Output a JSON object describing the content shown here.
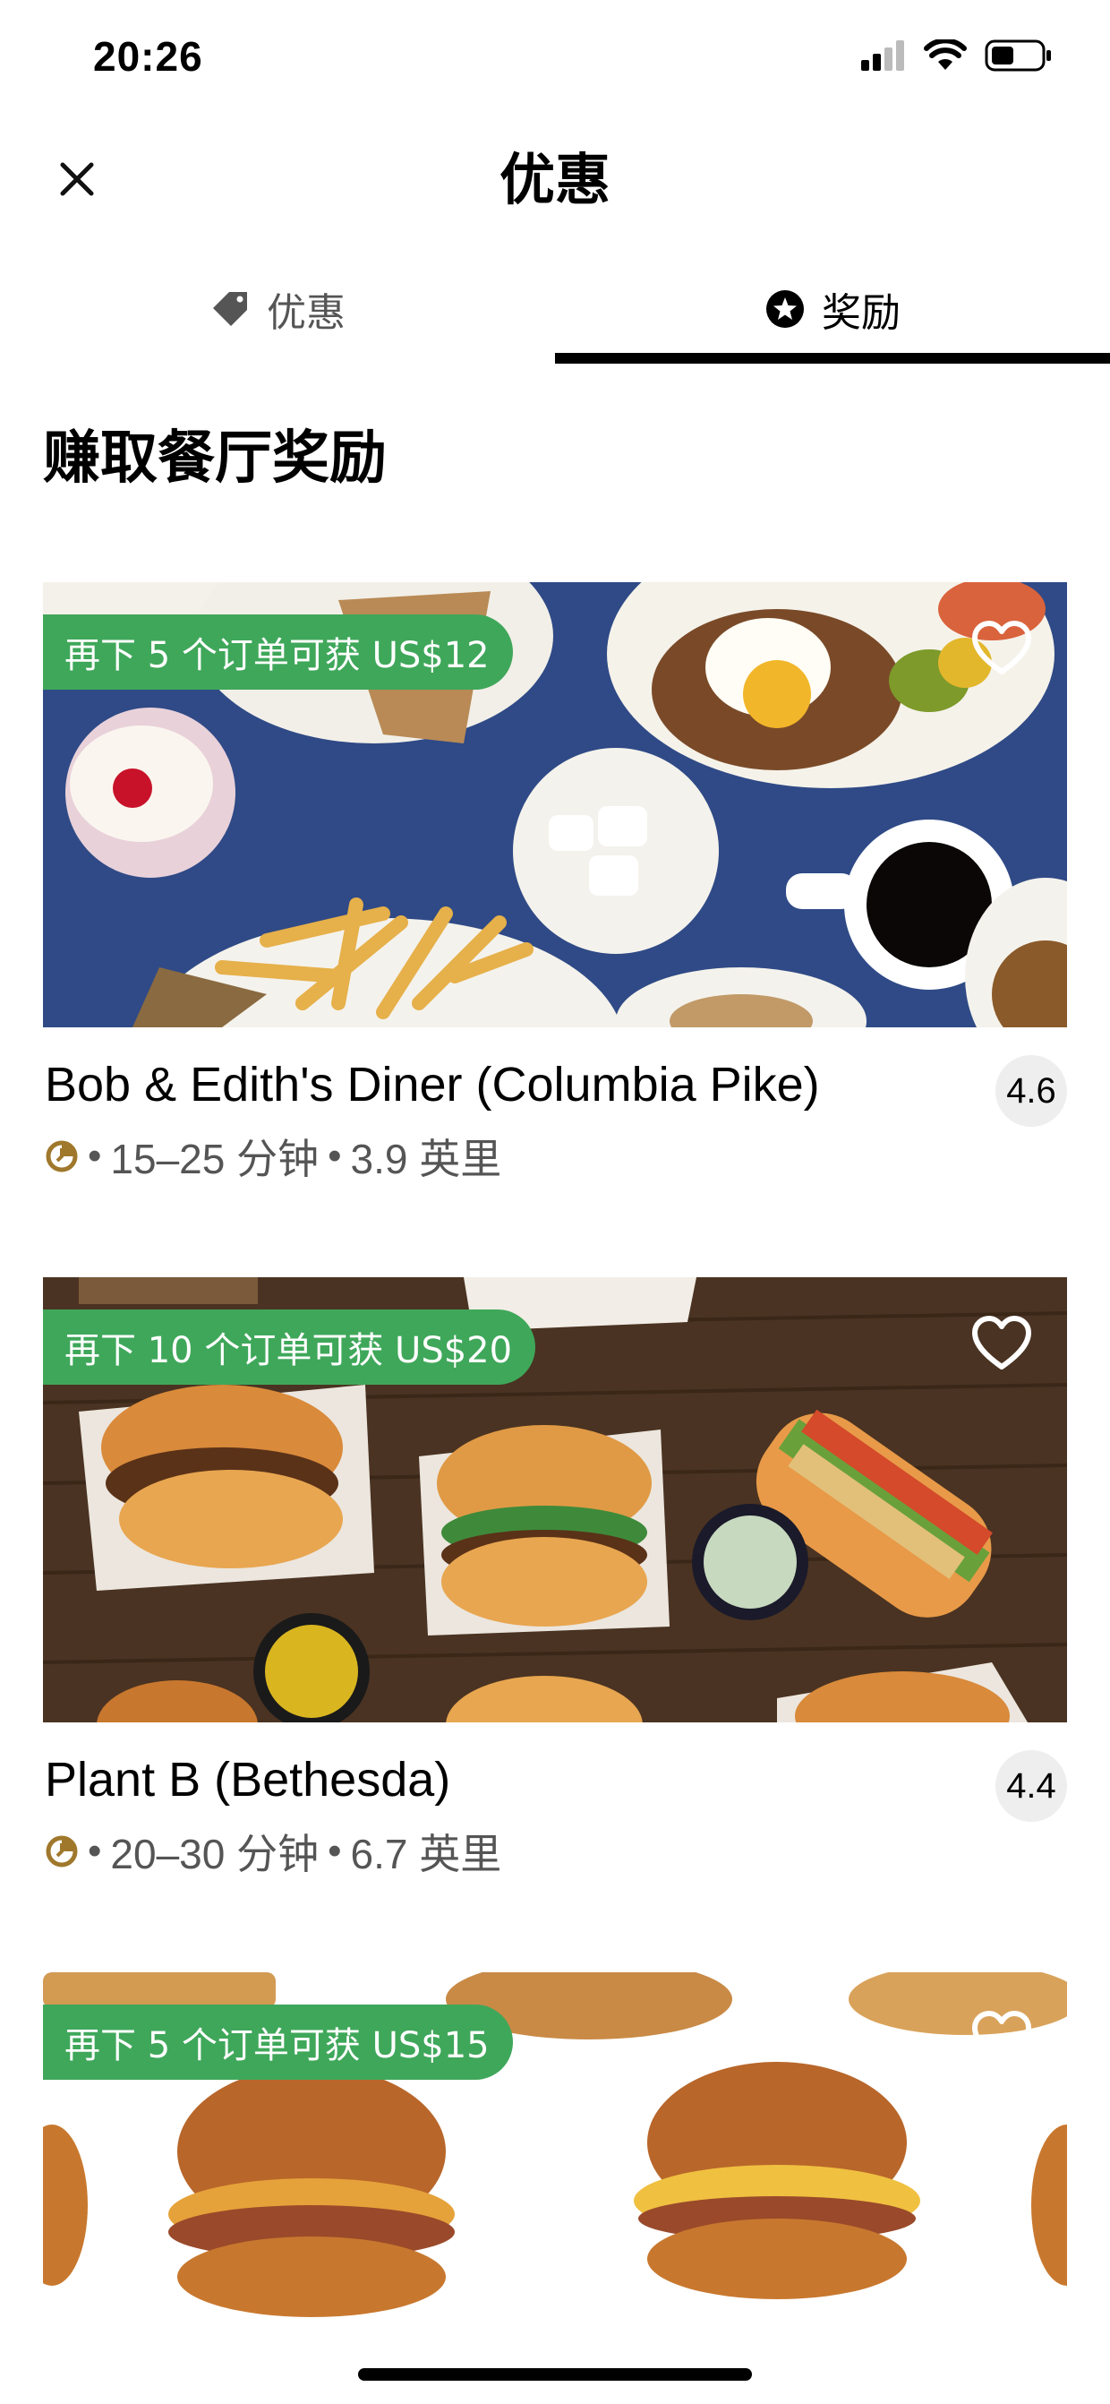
{
  "status_bar": {
    "time": "20:26"
  },
  "nav": {
    "title": "优惠",
    "close_icon": "close-icon"
  },
  "tabs": [
    {
      "label": "优惠",
      "icon": "tag-icon",
      "active": false
    },
    {
      "label": "奖励",
      "icon": "star-badge-icon",
      "active": true
    }
  ],
  "section_title": "赚取餐厅奖励",
  "colors": {
    "accent_green": "#3fa75a",
    "clock_gold": "#a0782c"
  },
  "restaurants": [
    {
      "badge": "再下 5 个订单可获 US$12",
      "name": "Bob & Edith's Diner (Columbia Pike)",
      "rating": "4.6",
      "time": "15–25 分钟",
      "distance": "3.9 英里"
    },
    {
      "badge": "再下 10 个订单可获 US$20",
      "name": "Plant B (Bethesda)",
      "rating": "4.4",
      "time": "20–30 分钟",
      "distance": "6.7 英里"
    },
    {
      "badge": "再下 5 个订单可获 US$15",
      "name": "",
      "rating": "",
      "time": "",
      "distance": ""
    }
  ]
}
